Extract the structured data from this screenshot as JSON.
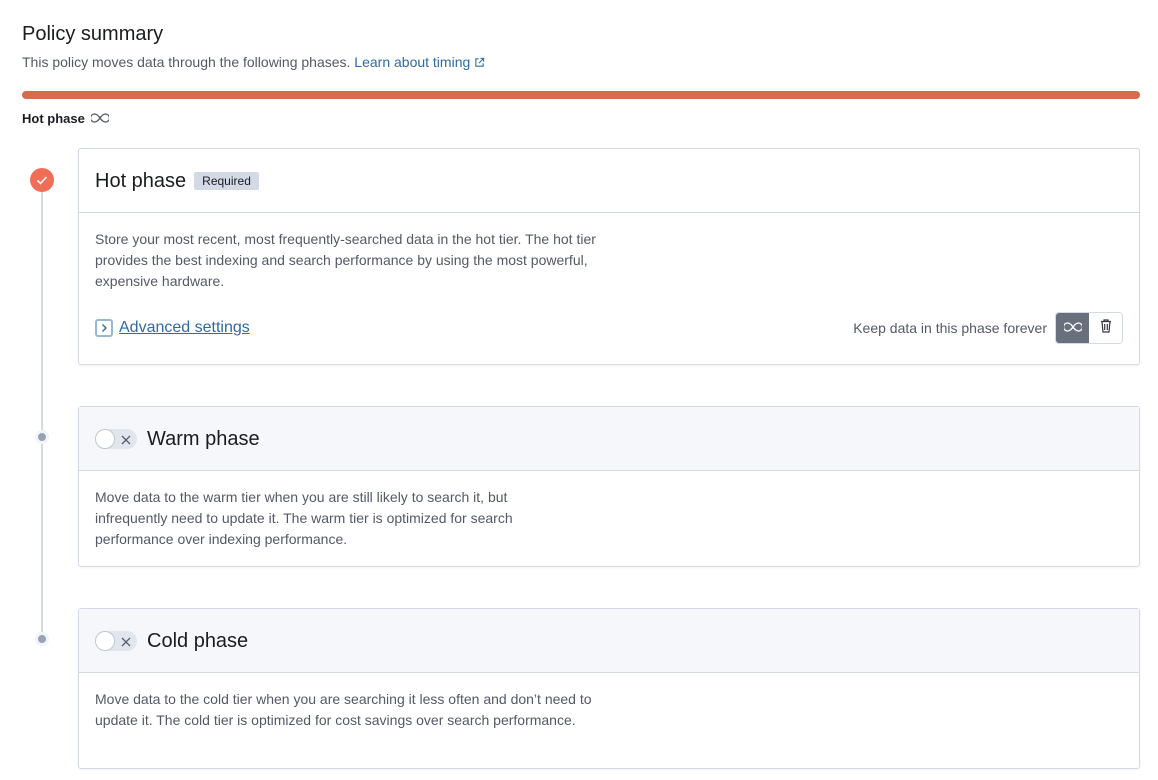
{
  "summary": {
    "title": "Policy summary",
    "subtitle": "This policy moves data through the following phases.",
    "learn_link": "Learn about timing",
    "bar_color": "#d56c4e",
    "legend_label": "Hot phase"
  },
  "phases": {
    "hot": {
      "title": "Hot phase",
      "badge": "Required",
      "description": "Store your most recent, most frequently-searched data in the hot tier. The hot tier provides the best indexing and search performance by using the most powerful, expensive hardware.",
      "advanced_link": "Advanced settings",
      "keep_label": "Keep data in this phase forever",
      "accent": "#f06e57"
    },
    "warm": {
      "title": "Warm phase",
      "enabled": false,
      "description": "Move data to the warm tier when you are still likely to search it, but infrequently need to update it. The warm tier is optimized for search performance over indexing performance."
    },
    "cold": {
      "title": "Cold phase",
      "enabled": false,
      "description": "Move data to the cold tier when you are searching it less often and don’t need to update it. The cold tier is optimized for cost savings over search performance."
    }
  },
  "icons": {
    "external_link": "external-link-icon",
    "infinity": "infinity-icon",
    "check": "check-icon",
    "chevron": "chevron-right-icon",
    "trash": "trash-icon",
    "cross": "cross-icon"
  }
}
